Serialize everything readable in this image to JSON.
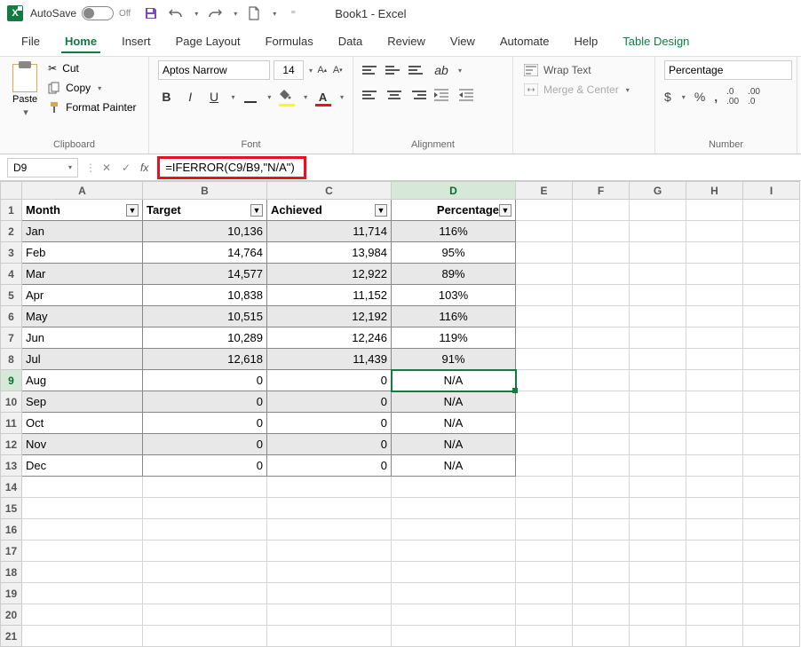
{
  "titlebar": {
    "autosave_label": "AutoSave",
    "autosave_state": "Off",
    "doc_title": "Book1 - Excel"
  },
  "tabs": {
    "items": [
      "File",
      "Home",
      "Insert",
      "Page Layout",
      "Formulas",
      "Data",
      "Review",
      "View",
      "Automate",
      "Help",
      "Table Design"
    ],
    "active": "Home"
  },
  "ribbon": {
    "clipboard": {
      "paste": "Paste",
      "cut": "Cut",
      "copy": "Copy",
      "format_painter": "Format Painter",
      "group_label": "Clipboard"
    },
    "font": {
      "name": "Aptos Narrow",
      "size": "14",
      "group_label": "Font"
    },
    "alignment": {
      "wrap_text": "Wrap Text",
      "merge_center": "Merge & Center",
      "group_label": "Alignment"
    },
    "number": {
      "format": "Percentage",
      "group_label": "Number"
    }
  },
  "formula_bar": {
    "cell_ref": "D9",
    "formula": "=IFERROR(C9/B9,\"N/A\")"
  },
  "columns": [
    "A",
    "B",
    "C",
    "D",
    "E",
    "F",
    "G",
    "H",
    "I"
  ],
  "selected_col": "D",
  "selected_row": 9,
  "table": {
    "headers": [
      "Month",
      "Target",
      "Achieved",
      "Percentage"
    ],
    "rows": [
      {
        "month": "Jan",
        "target": "10,136",
        "achieved": "11,714",
        "pct": "116%",
        "band": true
      },
      {
        "month": "Feb",
        "target": "14,764",
        "achieved": "13,984",
        "pct": "95%",
        "band": false
      },
      {
        "month": "Mar",
        "target": "14,577",
        "achieved": "12,922",
        "pct": "89%",
        "band": true
      },
      {
        "month": "Apr",
        "target": "10,838",
        "achieved": "11,152",
        "pct": "103%",
        "band": false
      },
      {
        "month": "May",
        "target": "10,515",
        "achieved": "12,192",
        "pct": "116%",
        "band": true
      },
      {
        "month": "Jun",
        "target": "10,289",
        "achieved": "12,246",
        "pct": "119%",
        "band": false
      },
      {
        "month": "Jul",
        "target": "12,618",
        "achieved": "11,439",
        "pct": "91%",
        "band": true
      },
      {
        "month": "Aug",
        "target": "0",
        "achieved": "0",
        "pct": "N/A",
        "band": false
      },
      {
        "month": "Sep",
        "target": "0",
        "achieved": "0",
        "pct": "N/A",
        "band": true
      },
      {
        "month": "Oct",
        "target": "0",
        "achieved": "0",
        "pct": "N/A",
        "band": false
      },
      {
        "month": "Nov",
        "target": "0",
        "achieved": "0",
        "pct": "N/A",
        "band": true
      },
      {
        "month": "Dec",
        "target": "0",
        "achieved": "0",
        "pct": "N/A",
        "band": false
      }
    ]
  },
  "empty_rows": [
    14,
    15,
    16,
    17,
    18,
    19,
    20,
    21
  ]
}
